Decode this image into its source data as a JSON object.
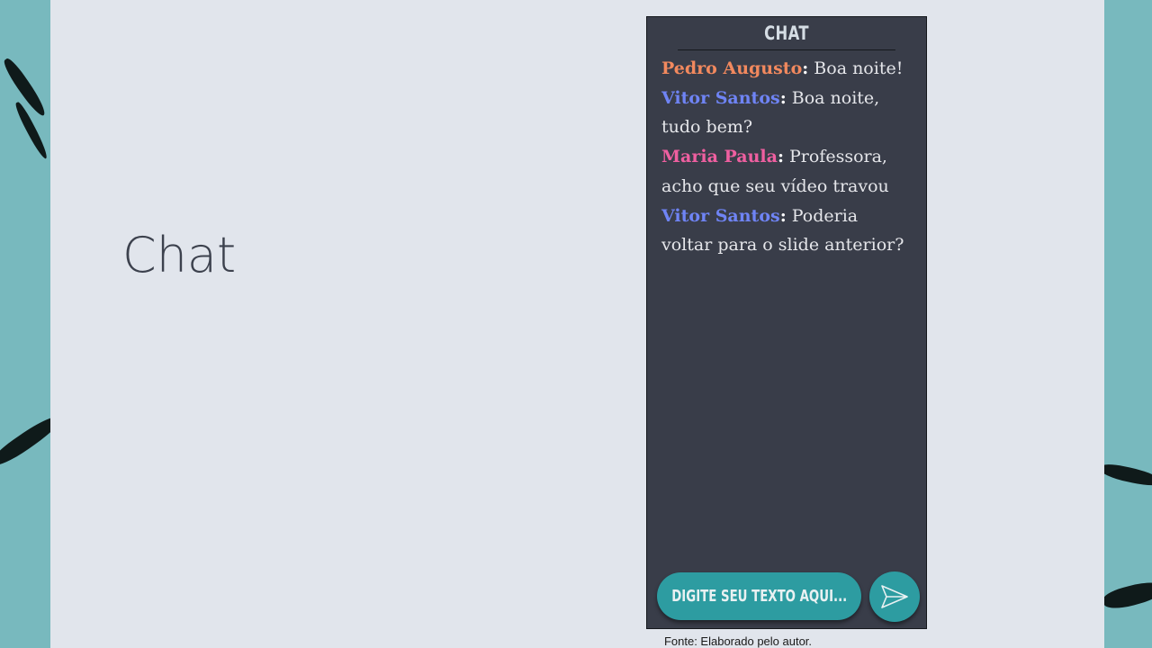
{
  "slide": {
    "title": "Chat",
    "caption": "Fonte: Elaborado pelo autor."
  },
  "chat": {
    "header": "CHAT",
    "messages": [
      {
        "author": "Pedro Augusto",
        "separator": ":",
        "text": " Boa noite!",
        "author_color": "#f2895e"
      },
      {
        "author": "Vitor Santos",
        "separator": ":",
        "text": " Boa noite, tudo bem?",
        "author_color": "#6f84f5"
      },
      {
        "author": "Maria Paula",
        "separator": ":",
        "text": " Professora, acho que seu vídeo travou",
        "author_color": "#ef5fa0"
      },
      {
        "author": "Vitor Santos",
        "separator": ":",
        "text": " Poderia voltar para o slide anterior?",
        "author_color": "#6f84f5"
      }
    ],
    "input_placeholder": "DIGITE SEU TEXTO AQUI...",
    "send_icon": "send-icon"
  },
  "colors": {
    "slide_bg": "#e1e5ec",
    "outer_bg": "#78b9be",
    "chat_bg": "#393d49",
    "accent": "#2d9ca1"
  }
}
